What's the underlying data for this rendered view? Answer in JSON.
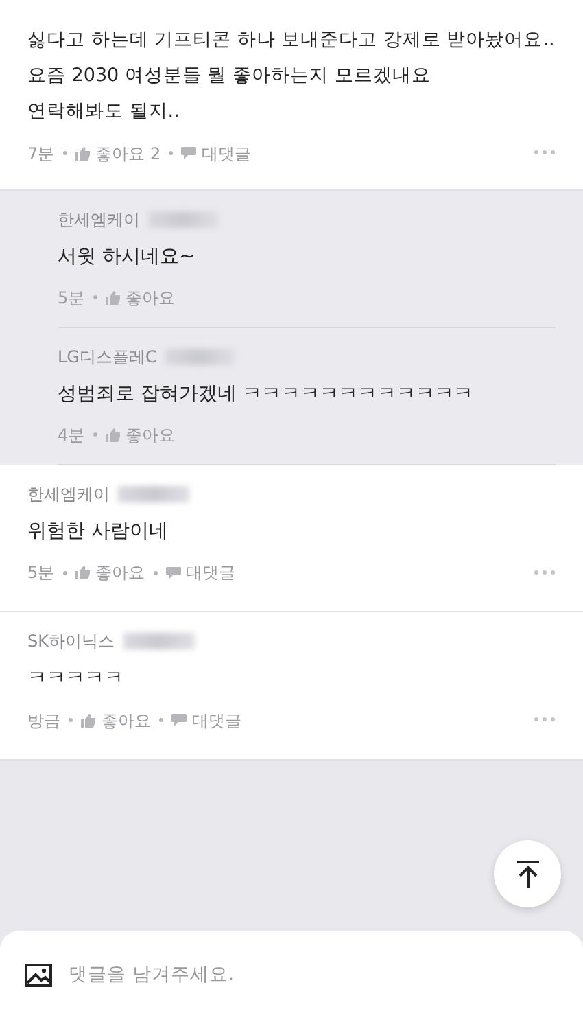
{
  "post_comment": {
    "lines": [
      "싫다고 하는데 기프티콘 하나 보내준다고 강제로 받아놨어요..",
      "요즘 2030 여성분들 뭘 좋아하는지 모르겠내요",
      "연락해봐도 될지.."
    ],
    "time": "7분",
    "like": "좋아요 2",
    "reply": "대댓글"
  },
  "comments": [
    {
      "kind": "reply",
      "company": "한세엠케이",
      "redacted": true,
      "text": "서윗 하시네요~",
      "time": "5분",
      "like": "좋아요"
    },
    {
      "kind": "reply",
      "company": "LG디스플레C",
      "redacted": true,
      "text": "성범죄로 잡혀가겠네 ㅋㅋㅋㅋㅋㅋㅋㅋㅋㅋㅋㅋ",
      "time": "4분",
      "like": "좋아요"
    },
    {
      "kind": "comment",
      "company": "한세엠케이",
      "redacted": true,
      "text": "위험한 사람이네",
      "time": "5분",
      "like": "좋아요",
      "reply": "대댓글"
    },
    {
      "kind": "comment",
      "company": "SK하이닉스",
      "redacted": true,
      "text": "ㅋㅋㅋㅋㅋ",
      "time": "방금",
      "like": "좋아요",
      "reply": "대댓글"
    }
  ],
  "comment_input": {
    "placeholder": "댓글을 남겨주세요."
  }
}
